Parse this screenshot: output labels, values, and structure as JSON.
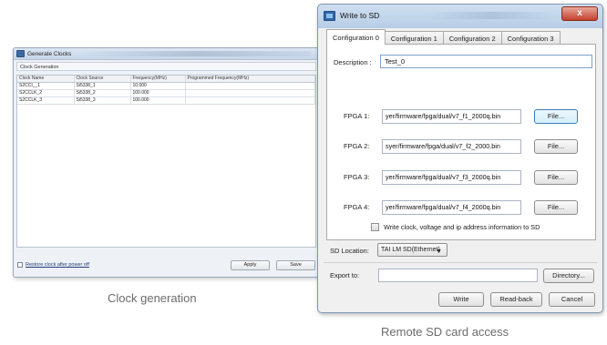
{
  "generate_clocks": {
    "title": "Generate Clocks",
    "group_label": "Clock Generation",
    "columns": [
      "Clock Name",
      "Clock Source",
      "Frequency(MHz)",
      "Programmed Frequency(MHz)"
    ],
    "rows": [
      [
        "S2CCI__1",
        "Si5338_1",
        "10.000",
        ""
      ],
      [
        "S2CCLK_2",
        "Si5338_2",
        "100.000",
        ""
      ],
      [
        "S2CCLK_3",
        "Si5338_3",
        "100.000",
        ""
      ]
    ],
    "restore_label": "Restore clock after power off",
    "apply_label": "Apply",
    "save_label": "Save"
  },
  "write_sd": {
    "title": "Write to SD",
    "close_glyph": "x",
    "tabs": [
      "Configuration 0",
      "Configuration 1",
      "Configuration 2",
      "Configuration 3"
    ],
    "active_tab": 0,
    "description_label": "Description :",
    "description_value": "Test_0",
    "fpgas": [
      {
        "label": "FPGA 1:",
        "path": "yer/firmware/fpga/dual/v7_f1_2000q.bin",
        "button": "File..."
      },
      {
        "label": "FPGA 2:",
        "path": "syer/firmware/fpga/dual/v7_f2_2000.bin",
        "button": "File..."
      },
      {
        "label": "FPGA 3:",
        "path": "yer/firmware/fpga/dual/v7_f3_2000q.bin",
        "button": "File..."
      },
      {
        "label": "FPGA 4:",
        "path": "yer/firmware/fpga/dual/v7_f4_2000q.bin",
        "button": "File..."
      }
    ],
    "write_info_label": "Write clock, voltage and ip address information to SD",
    "sd_location_label": "SD Location:",
    "sd_location_value": "TAI LM SD(Ethernet)",
    "export_label": "Export to:",
    "export_value": "",
    "directory_label": "Directory...",
    "write_label": "Write",
    "readback_label": "Read-back",
    "cancel_label": "Cancel"
  },
  "captions": {
    "left": "Clock generation",
    "right": "Remote SD card access"
  }
}
